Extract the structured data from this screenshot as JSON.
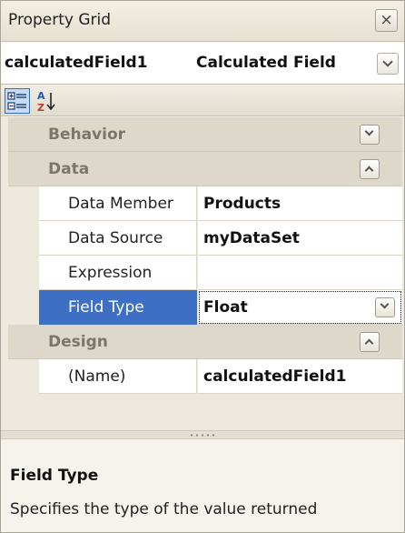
{
  "window": {
    "title": "Property Grid",
    "close_glyph": "×"
  },
  "selector": {
    "object_name": "calculatedField1",
    "object_type": "Calculated Field"
  },
  "toolbar": {
    "categorized_icon": "categorized-view-icon",
    "alphabetical_icon": "alphabetical-sort-icon",
    "alpha_top": "A",
    "alpha_bottom": "Z"
  },
  "categories": [
    {
      "label": "Behavior",
      "expanded": false,
      "properties": []
    },
    {
      "label": "Data",
      "expanded": true,
      "properties": [
        {
          "name": "Data Member",
          "value": "Products"
        },
        {
          "name": "Data Source",
          "value": "myDataSet"
        },
        {
          "name": "Expression",
          "value": ""
        },
        {
          "name": "Field Type",
          "value": "Float",
          "selected": true,
          "has_dropdown": true
        }
      ]
    },
    {
      "label": "Design",
      "expanded": true,
      "properties": [
        {
          "name": "(Name)",
          "value": "calculatedField1"
        }
      ]
    }
  ],
  "description": {
    "title": "Field Type",
    "text": "Specifies the type of the value returned"
  },
  "colors": {
    "selection": "#3d6fc4",
    "category_background": "#ddd8c9",
    "category_text": "#7b7768"
  }
}
